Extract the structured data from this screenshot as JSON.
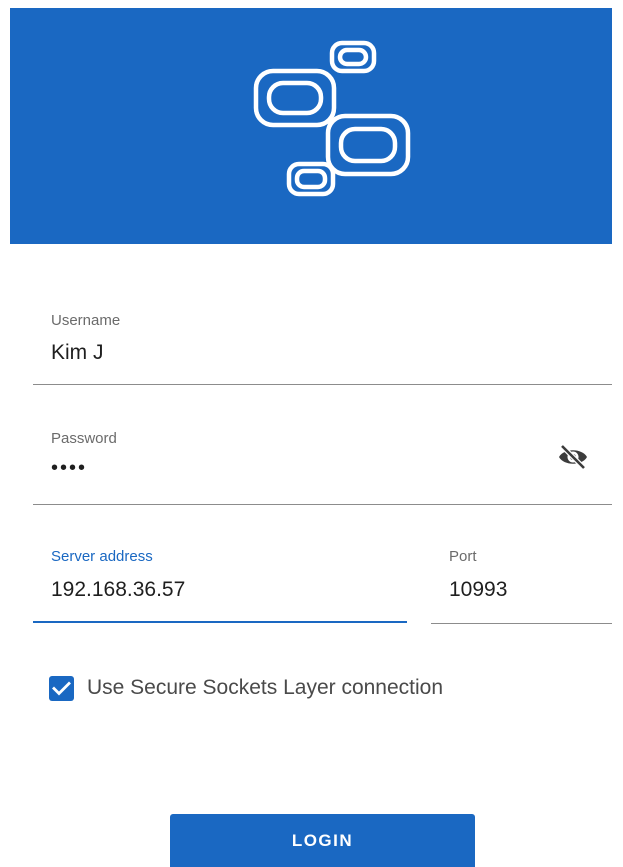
{
  "banner": {
    "logo_icon": "linked-rounded-rectangles-logo-icon",
    "color": "#1a68c2"
  },
  "form": {
    "username": {
      "label": "Username",
      "value": "Kim J"
    },
    "password": {
      "label": "Password",
      "value": "••••",
      "toggle_icon": "eye-off-icon"
    },
    "server": {
      "label": "Server address",
      "value": "192.168.36.57"
    },
    "port": {
      "label": "Port",
      "value": "10993"
    },
    "ssl": {
      "label": "Use Secure Sockets Layer connection",
      "checked": true
    }
  },
  "actions": {
    "login_label": "LOGIN"
  },
  "colors": {
    "accent": "#1a68c2",
    "underline": "#8c8c8c",
    "label": "#6b6b6b"
  }
}
